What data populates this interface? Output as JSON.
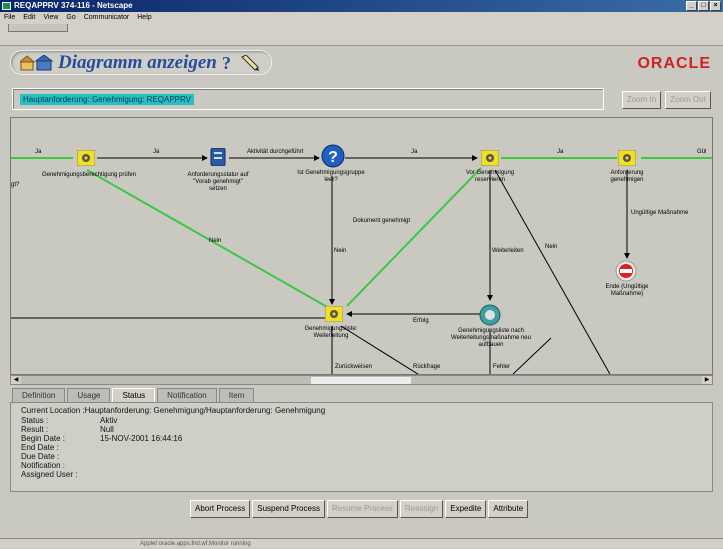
{
  "window": {
    "title": "REQAPPRV 374-116 - Netscape"
  },
  "menu": [
    "File",
    "Edit",
    "View",
    "Go",
    "Communicator",
    "Help"
  ],
  "header": {
    "title": "Diagramm anzeigen",
    "help": "?",
    "brand": "ORACLE"
  },
  "breadcrumb": "Hauptanforderung: Genehmigung: REQAPPRV",
  "zoom": {
    "in": "Zoom In",
    "out": "Zoom Out"
  },
  "diagram": {
    "nodes": {
      "genehm": "Genehmigungsberechtigung prüfen",
      "status": "Anforderungsstatur auf \"Vorab genehmigt\" setzen",
      "gruppe": "Ist Genehmigungsgruppe leer?",
      "reserv": "Vor Genehmigung reservieren",
      "anford": "Anforderung genehmigen",
      "ende": "Ende (Ungültige Maßnahme)",
      "weiter": "Genehmigungsliste: Weiterleitung",
      "liste": "Genehmigungsliste nach Weiterleitungsmaßnahme neu aufbauen"
    },
    "edges": {
      "ja": "Ja",
      "ja2": "Ja",
      "aktivitaet": "Aktivität durchgeführt",
      "ja3": "Ja",
      "ja4": "Ja",
      "gul": "Gül",
      "gt": "gt?",
      "nein1": "Nein",
      "nein2": "Nein",
      "nein3": "Nein",
      "dok": "Dokument genehmigt",
      "weiterleiten": "Weiterleiten",
      "ungueltig": "Ungültige Maßnahme",
      "erfolg": "Erfolg",
      "zurueck": "Zurückweisen",
      "rueck": "Rückfrage",
      "fehler": "Fehler"
    }
  },
  "tabs": [
    "Definition",
    "Usage",
    "Status",
    "Notification",
    "Item"
  ],
  "details": {
    "current_location": "Current Location :Hauptanforderung: Genehmigung/Hauptanforderung: Genehmigung",
    "rows": [
      {
        "k": "Status :",
        "v": "Aktiv"
      },
      {
        "k": "Result :",
        "v": "Null"
      },
      {
        "k": "Begin Date :",
        "v": "15-NOV-2001 16:44:16"
      },
      {
        "k": "End Date :",
        "v": ""
      },
      {
        "k": "Due Date :",
        "v": ""
      },
      {
        "k": "Notification :",
        "v": ""
      },
      {
        "k": "Assigned User :",
        "v": ""
      }
    ]
  },
  "actions": {
    "abort": "Abort Process",
    "suspend": "Suspend Process",
    "resume": "Resume Process",
    "reassign": "Reassign",
    "expedite": "Expedite",
    "attribute": "Attribute"
  },
  "statusbar": "Applet oracle.apps.fnd.wf.Monitor running",
  "colors": {
    "accent": "#2a4a9a",
    "brand": "#d02020",
    "green": "#3ec83e",
    "highlight": "#27c0c0"
  }
}
